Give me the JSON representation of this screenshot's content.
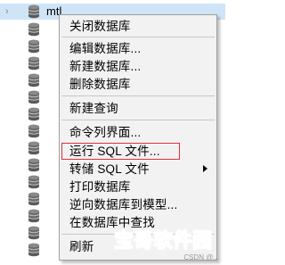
{
  "tree": {
    "expand_glyph": "›",
    "selected_db": "mtl",
    "icon": "database-icon"
  },
  "menu": {
    "close_db": "关闭数据库",
    "edit_db": "编辑数据库...",
    "new_db": "新建数据库...",
    "delete_db": "删除数据库",
    "new_query": "新建查询",
    "console": "命令列界面...",
    "run_sql": "运行 SQL 文件...",
    "dump_sql": "转储 SQL 文件",
    "print_db": "打印数据库",
    "reverse_model": "逆向数据库到模型...",
    "find_in_db": "在数据库中查找",
    "refresh": "刷新"
  },
  "watermark": {
    "brand": "宝哥软件园",
    "sub": "CSDN @..."
  },
  "colors": {
    "menu_bg": "#f2f2f2",
    "highlight_border": "#e0303a",
    "selection_bg": "#cfe4f7",
    "watermark": "#ff2a36"
  }
}
